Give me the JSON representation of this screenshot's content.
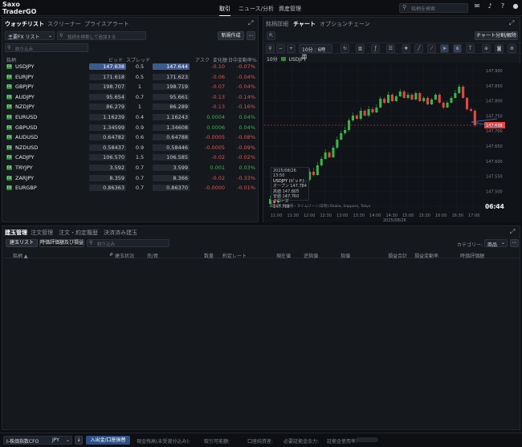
{
  "app": {
    "logo_line1": "Saxo",
    "logo_line2": "TraderGO"
  },
  "nav": {
    "items": [
      "取引",
      "ニュース/分析",
      "資産管理"
    ],
    "search_placeholder": "銘柄を検索"
  },
  "watchlist": {
    "tabs": [
      "ウォッチリスト",
      "スクリーナー",
      "プライスアラート"
    ],
    "list_selector": "主要FX  リスト",
    "search_placeholder": "銘柄を検索して追加する",
    "new_button": "新規作成",
    "more": "⋯",
    "filter_placeholder": "絞り込み",
    "columns": [
      "銘柄",
      "ビッド",
      "スプレッド",
      "アスク",
      "変化額",
      "日中変動率%"
    ],
    "rows": [
      {
        "sym": "USDJPY",
        "bid": "147.638",
        "spread": "0.5",
        "ask": "147.644",
        "chg": "-0.10",
        "pct": "-0.07%",
        "dir": "",
        "hl": true,
        "up": false
      },
      {
        "sym": "EURJPY",
        "bid": "171.618",
        "spread": "0.5",
        "ask": "171.623",
        "chg": "-0.06",
        "pct": "-0.04%",
        "dir": "↓",
        "hl": false,
        "up": false
      },
      {
        "sym": "GBPJPY",
        "bid": "198.707",
        "spread": "1",
        "ask": "198.719",
        "chg": "-0.07",
        "pct": "-0.04%",
        "dir": "",
        "hl": false,
        "up": false
      },
      {
        "sym": "AUDJPY",
        "bid": "95.654",
        "spread": "0.7",
        "ask": "95.661",
        "chg": "-0.13",
        "pct": "-0.14%",
        "dir": "↓",
        "hl": false,
        "up": false
      },
      {
        "sym": "NZDJPY",
        "bid": "86.279",
        "spread": "1",
        "ask": "86.289",
        "chg": "-0.13",
        "pct": "-0.16%",
        "dir": "↓",
        "hl": false,
        "up": false
      },
      {
        "sym": "EURUSD",
        "bid": "1.16239",
        "spread": "0.4",
        "ask": "1.16243",
        "chg": "0.0004",
        "pct": "0.04%",
        "dir": "↓",
        "hl": false,
        "up": true
      },
      {
        "sym": "GBPUSD",
        "bid": "1.34599",
        "spread": "0.9",
        "ask": "1.34608",
        "chg": "0.0006",
        "pct": "0.04%",
        "dir": "↓",
        "hl": false,
        "up": true
      },
      {
        "sym": "AUDUSD",
        "bid": "0.64782",
        "spread": "0.6",
        "ask": "0.64788",
        "chg": "-0.0005",
        "pct": "-0.08%",
        "dir": "",
        "hl": false,
        "up": false
      },
      {
        "sym": "NZDUSD",
        "bid": "0.58437",
        "spread": "0.9",
        "ask": "0.58446",
        "chg": "-0.0005",
        "pct": "-0.09%",
        "dir": "↓",
        "hl": false,
        "up": false
      },
      {
        "sym": "CADJPY",
        "bid": "106.570",
        "spread": "1.5",
        "ask": "106.585",
        "chg": "-0.02",
        "pct": "-0.02%",
        "dir": "↓",
        "hl": false,
        "up": false
      },
      {
        "sym": "TRYJPY",
        "bid": "3.592",
        "spread": "0.7",
        "ask": "3.599",
        "chg": "0.001",
        "pct": "0.03%",
        "dir": "",
        "hl": false,
        "up": true
      },
      {
        "sym": "ZARJPY",
        "bid": "8.359",
        "spread": "0.7",
        "ask": "8.366",
        "chg": "-0.02",
        "pct": "-0.33%",
        "dir": "↑",
        "hl": false,
        "up": false
      },
      {
        "sym": "EURGBP",
        "bid": "0.86363",
        "spread": "0.7",
        "ask": "0.86370",
        "chg": "-0.0000",
        "pct": "-0.01%",
        "dir": "↓",
        "hl": false,
        "up": false
      }
    ]
  },
  "chart": {
    "tabs": [
      "銘柄詳細",
      "チャート",
      "オプションチェーン"
    ],
    "timeframe": "10分 : 6時間",
    "trade_button": "チャート分割/解除",
    "instrument_label": "USDJPY",
    "tf_short": "10分",
    "price_ticks": [
      "147.900",
      "147.850",
      "147.800",
      "147.750",
      "147.700",
      "147.650",
      "147.600",
      "147.550",
      "147.500",
      "147.450"
    ],
    "current_price": "147.638",
    "time_ticks": [
      "11:00",
      "11:30",
      "12:00",
      "12:30",
      "13:00",
      "13:30",
      "14:00",
      "14:30",
      "15:00",
      "15:30",
      "16:00",
      "16:30",
      "17:00"
    ],
    "date_label": "2025/08/26",
    "countdown": "06:44",
    "session_note": "取引所 時間帯・タイムゾーン(日時):Osaka, Sapporo, Tokyo",
    "tooltip": {
      "date": "2025/08/26 13:50",
      "name": "USDJPY (ビッド)",
      "open_label": "オープン",
      "open": "147.784",
      "high_label": "高値",
      "high": "147.805",
      "low_label": "安値",
      "low": "147.760",
      "close_label": "クローズ",
      "close": "147.768"
    },
    "candle_colors": {
      "up": "#3bb34a",
      "down": "#e5463f"
    }
  },
  "positions": {
    "tabs": [
      "建玉管理",
      "注文管理",
      "注文・約定履歴",
      "決済済み建玉"
    ],
    "sub_tabs": [
      "建玉リスト",
      "時価評価額及び損益"
    ],
    "filter_placeholder": "絞り込み",
    "category_label": "カテゴリー:",
    "category_value": "商品",
    "columns": [
      "銘柄 ▲",
      "#",
      "建玉状況",
      "売/買",
      "数量",
      "約定レート",
      "現在値",
      "逆指値",
      "指値",
      "損益合計",
      "損益変動率",
      "時価評価額"
    ]
  },
  "bottom": {
    "account": "I-株価指数CFO",
    "currency": "JPY",
    "deposit_button": "入出金/口座振替",
    "items": [
      "現金残高(未受渡分込み):",
      "取引可能額:",
      "口座純資産:",
      "必要証拠金余力:",
      "証拠金使用率:"
    ]
  }
}
